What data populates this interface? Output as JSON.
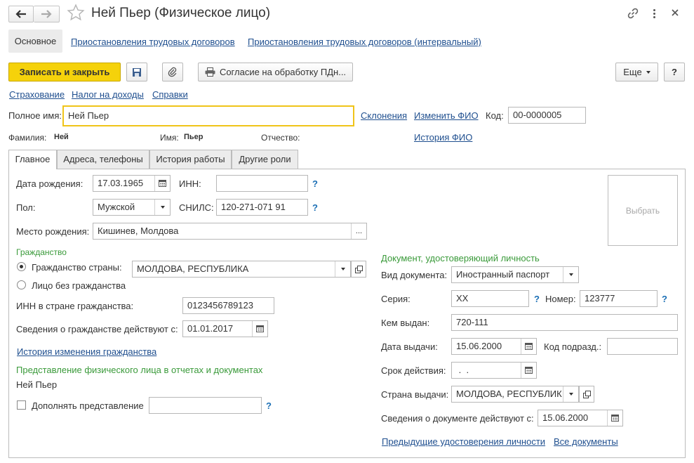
{
  "window": {
    "title": "Ней Пьер (Физическое лицо)"
  },
  "nav_tabs": [
    {
      "label": "Основное"
    },
    {
      "label": "Приостановления трудовых договоров"
    },
    {
      "label": "Приостановления трудовых договоров (интервальный)"
    }
  ],
  "toolbar": {
    "save_close": "Записать и закрыть",
    "consent": "Согласие на обработку ПДн...",
    "more": "Еще",
    "help": "?"
  },
  "links": {
    "insurance": "Страхование",
    "income_tax": "Налог на доходы",
    "certificates": "Справки"
  },
  "person": {
    "full_name_label": "Полное имя:",
    "full_name_value": "Ней Пьер",
    "declensions": "Склонения",
    "change_fio": "Изменить ФИО",
    "code_label": "Код:",
    "code_value": "00-0000005",
    "surname_label": "Фамилия:",
    "surname_value": "Ней",
    "name_label": "Имя:",
    "name_value": "Пьер",
    "patronymic_label": "Отчество:",
    "fio_history": "История ФИО"
  },
  "form_tabs": [
    {
      "label": "Главное"
    },
    {
      "label": "Адреса, телефоны"
    },
    {
      "label": "История работы"
    },
    {
      "label": "Другие роли"
    }
  ],
  "main": {
    "birth_date_label": "Дата рождения:",
    "birth_date_value": "17.03.1965",
    "inn_label": "ИНН:",
    "inn_value": "",
    "gender_label": "Пол:",
    "gender_value": "Мужской",
    "snils_label": "СНИЛС:",
    "snils_value": "120-271-071 91",
    "birth_place_label": "Место рождения:",
    "birth_place_value": "Кишинев, Молдова",
    "photo_select": "Выбрать",
    "help_mark": "?"
  },
  "citizenship": {
    "header": "Гражданство",
    "country_option": "Гражданство страны:",
    "country_value": "МОЛДОВА, РЕСПУБЛИКА",
    "stateless_option": "Лицо без гражданства",
    "inn_country_label": "ИНН в стране гражданства:",
    "inn_country_value": "0123456789123",
    "valid_from_label": "Сведения о гражданстве действуют с:",
    "valid_from_value": "01.01.2017",
    "history_link": "История изменения гражданства",
    "selected": "country"
  },
  "representation": {
    "header": "Представление физического лица в отчетах и документах",
    "value": "Ней Пьер",
    "supplement_label": "Дополнять представление",
    "supplement_value": "",
    "supplement_checked": false
  },
  "document": {
    "header": "Документ, удостоверяющий личность",
    "type_label": "Вид документа:",
    "type_value": "Иностранный паспорт",
    "series_label": "Серия:",
    "series_value": "XX",
    "number_label": "Номер:",
    "number_value": "123777",
    "issued_by_label": "Кем выдан:",
    "issued_by_value": "720-111",
    "issue_date_label": "Дата выдачи:",
    "issue_date_value": "15.06.2000",
    "dept_code_label": "Код подразд.:",
    "dept_code_value": "",
    "expiry_label": "Срок действия:",
    "expiry_value": " .  .",
    "country_label": "Страна выдачи:",
    "country_value": "МОЛДОВА, РЕСПУБЛИК",
    "valid_from_label": "Сведения о документе действуют с:",
    "valid_from_value": "15.06.2000",
    "prev_docs_link": "Предыдущие удостоверения личности",
    "all_docs_link": "Все документы"
  },
  "colors": {
    "accent_yellow": "#f5d20b",
    "link_blue": "#1f4f8f",
    "section_green": "#3a9a3a",
    "help_blue": "#1b6fb5"
  }
}
